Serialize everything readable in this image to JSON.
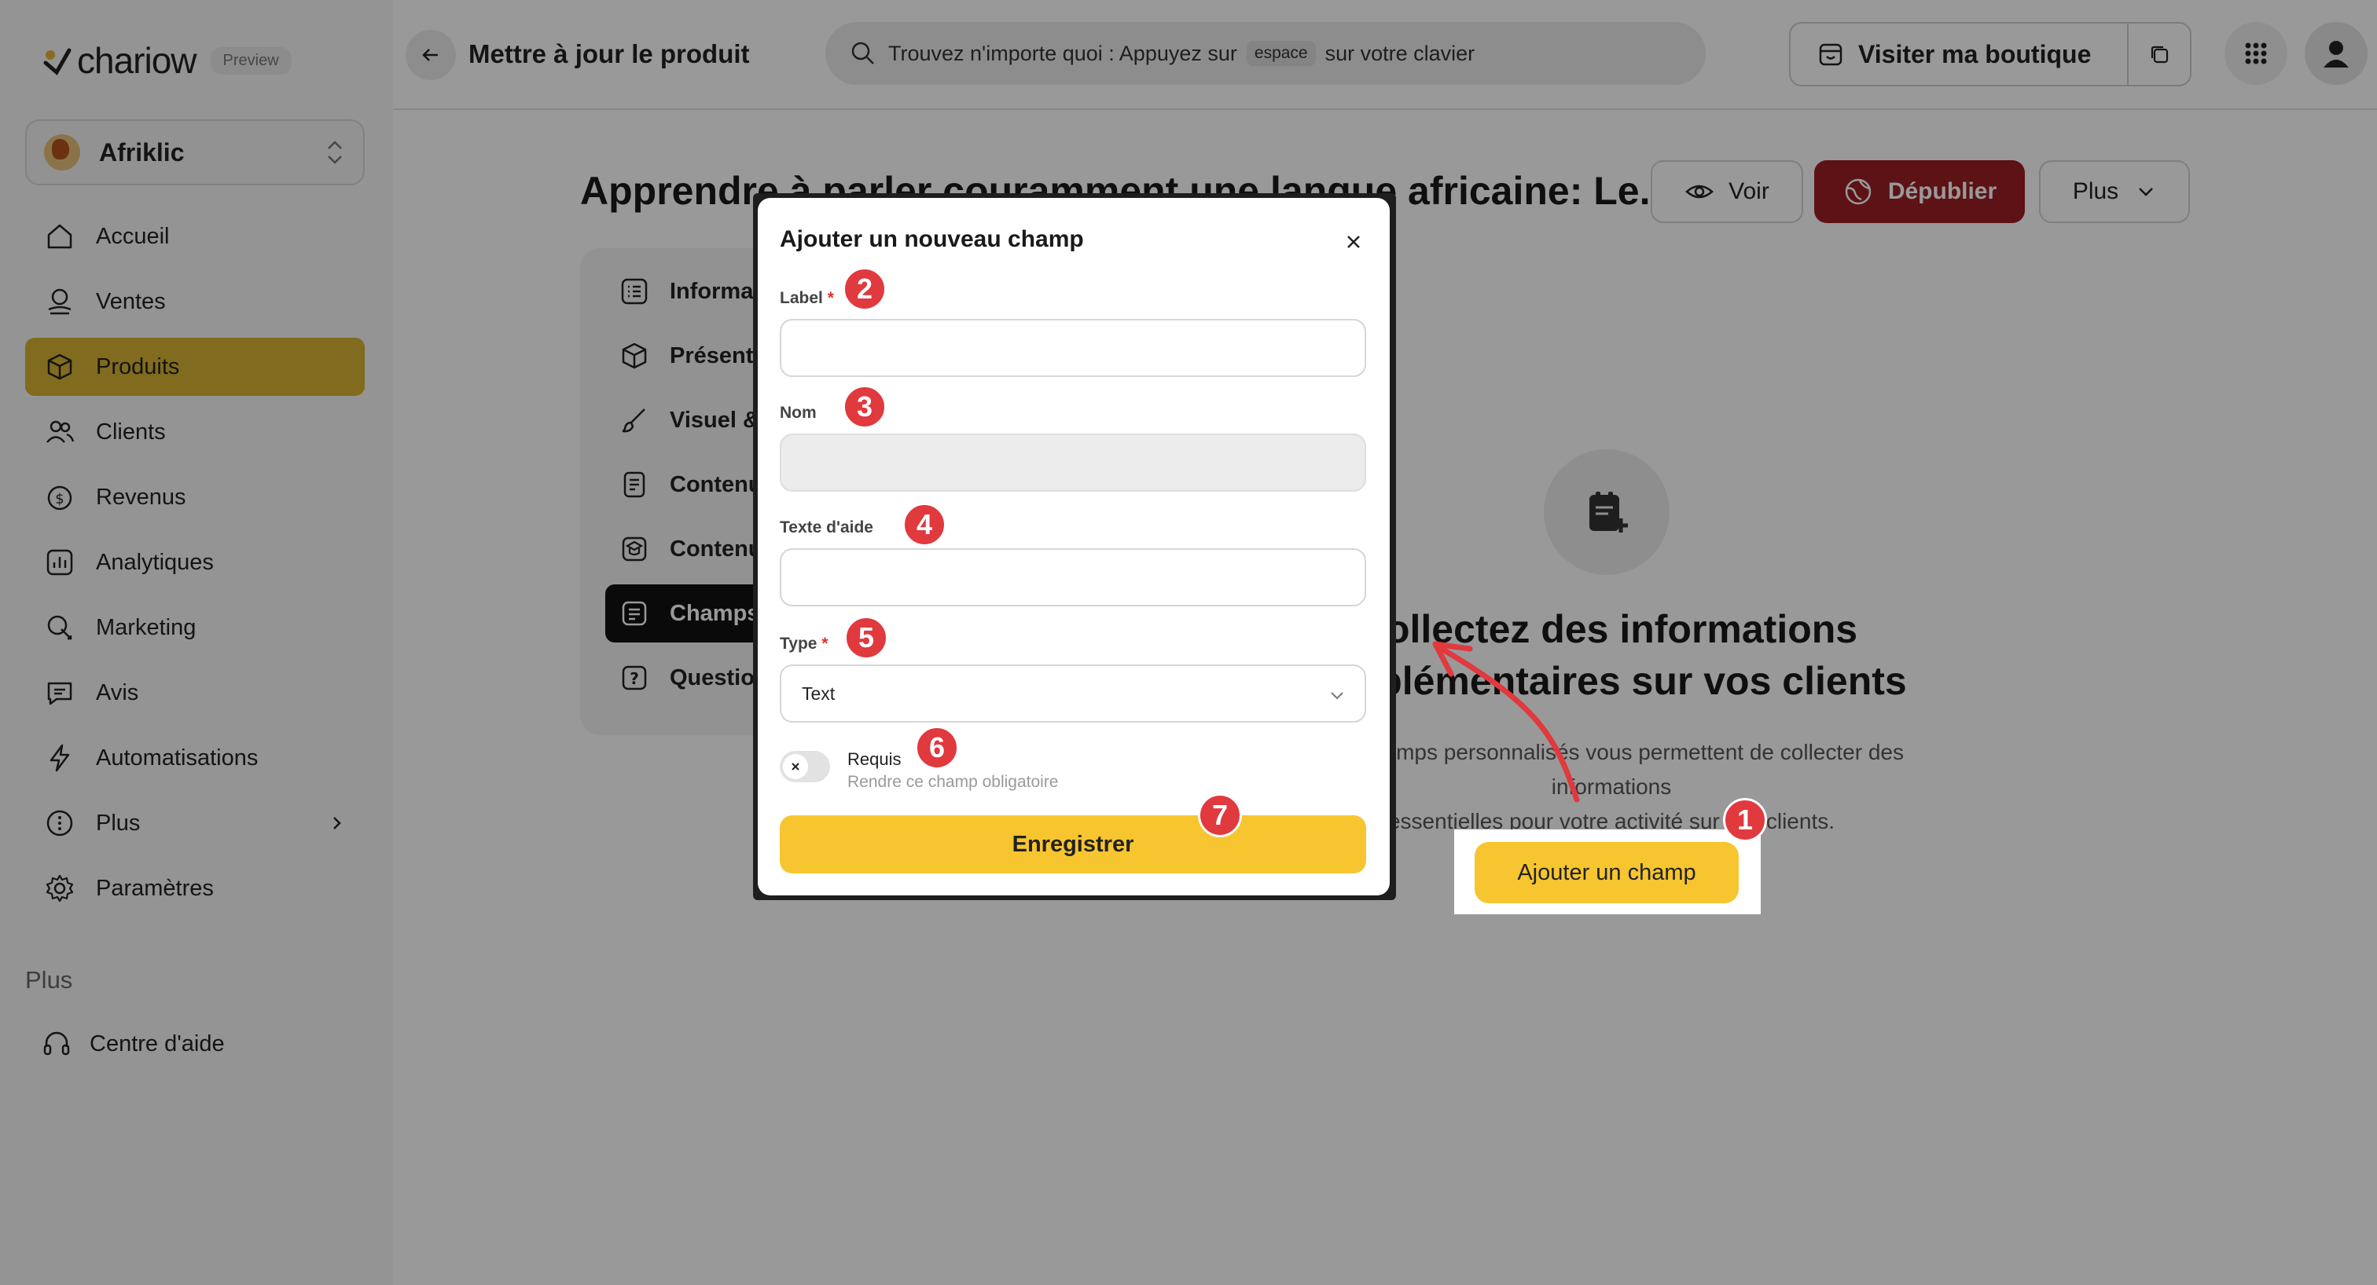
{
  "app": {
    "logo_text": "chariow",
    "preview_badge": "Preview",
    "store_name": "Afriklic",
    "store_logo_label": "AfriClic"
  },
  "sidebar": {
    "items": [
      {
        "label": "Accueil",
        "icon": "home-icon"
      },
      {
        "label": "Ventes",
        "icon": "sales-icon"
      },
      {
        "label": "Produits",
        "icon": "box-icon",
        "active": true
      },
      {
        "label": "Clients",
        "icon": "users-icon"
      },
      {
        "label": "Revenus",
        "icon": "revenue-icon"
      },
      {
        "label": "Analytiques",
        "icon": "chart-icon"
      },
      {
        "label": "Marketing",
        "icon": "marketing-icon"
      },
      {
        "label": "Avis",
        "icon": "review-icon"
      },
      {
        "label": "Automatisations",
        "icon": "lightning-icon"
      },
      {
        "label": "Plus",
        "icon": "more-icon"
      },
      {
        "label": "Paramètres",
        "icon": "gear-icon"
      }
    ],
    "section_title": "Plus",
    "help_label": "Centre d'aide"
  },
  "header": {
    "title": "Mettre à jour le produit",
    "search_prefix": "Trouvez n'importe quoi : Appuyez sur",
    "search_key": "espace",
    "search_suffix": "sur votre clavier",
    "visit_label": "Visiter ma boutique"
  },
  "product": {
    "title": "Apprendre à parler couramment une langue africaine: Le...",
    "view_label": "Voir",
    "unpublish_label": "Dépublier",
    "more_label": "Plus"
  },
  "tabs": [
    {
      "label": "Informations",
      "icon": "list-icon"
    },
    {
      "label": "Présentation",
      "icon": "box-icon"
    },
    {
      "label": "Visuel & médias",
      "icon": "brush-icon"
    },
    {
      "label": "Contenu",
      "icon": "document-icon"
    },
    {
      "label": "Contenu cours",
      "icon": "course-icon"
    },
    {
      "label": "Champs",
      "icon": "form-icon",
      "active": true
    },
    {
      "label": "Questions",
      "icon": "question-icon"
    }
  ],
  "empty_state": {
    "title_line1": "Collectez des informations",
    "title_line2": "supplémentaires sur vos clients",
    "desc_line1": "Les champs personnalisés vous permettent de collecter des informations",
    "desc_line2": "essentielles pour votre activité sur vos clients.",
    "cta_label": "Ajouter un champ"
  },
  "modal": {
    "title": "Ajouter un nouveau champ",
    "label_field": {
      "label": "Label",
      "required_mark": "*",
      "value": ""
    },
    "name_field": {
      "label": "Nom",
      "value": ""
    },
    "help_field": {
      "label": "Texte d'aide",
      "value": ""
    },
    "type_field": {
      "label": "Type",
      "required_mark": "*",
      "value": "Text"
    },
    "required_toggle": {
      "label": "Requis",
      "help": "Rendre ce champ obligatoire",
      "on": false
    },
    "save_label": "Enregistrer"
  },
  "markers": [
    "1",
    "2",
    "3",
    "4",
    "5",
    "6",
    "7"
  ],
  "colors": {
    "accent": "#f7c52f",
    "nav_active": "#d8b232",
    "danger": "#9b1f23",
    "marker": "#e0393e"
  }
}
